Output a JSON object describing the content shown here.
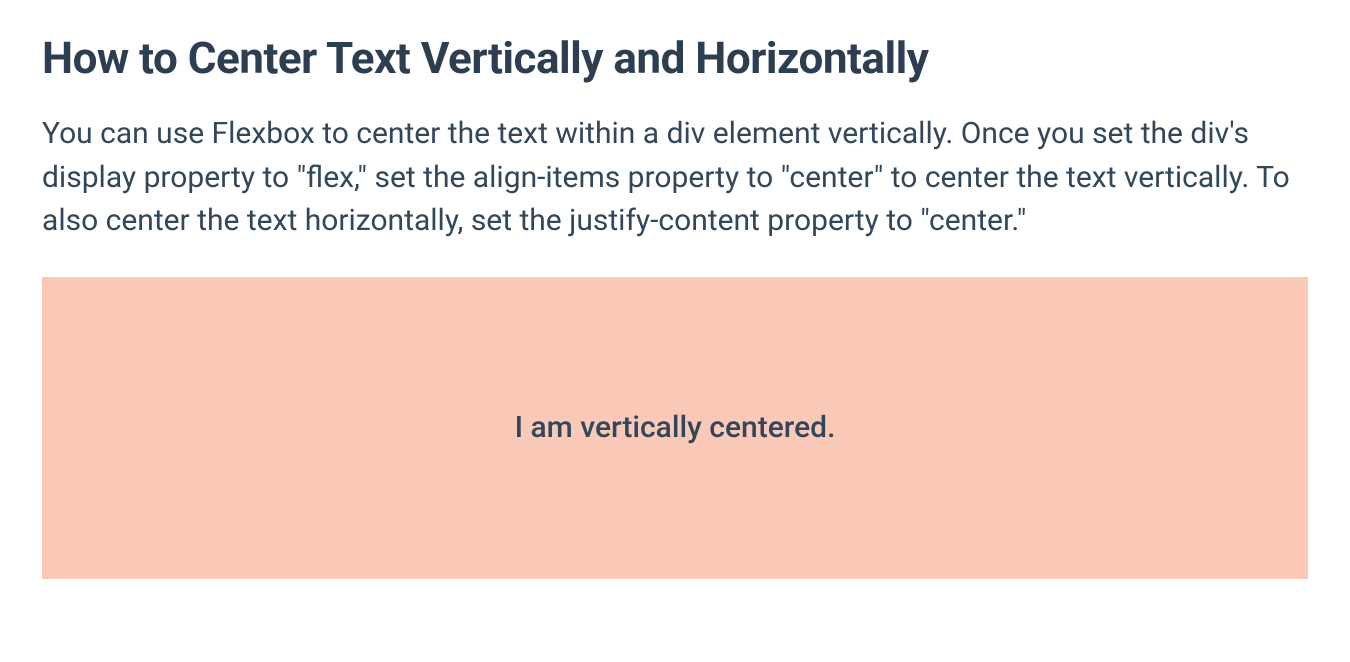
{
  "heading": "How to Center Text Vertically and Horizontally",
  "paragraph": "You can use Flexbox to center the text within a div element vertically. Once you set the div's display property to \"flex,\" set the align-items property to \"center\" to center the text vertically. To also center the text horizontally, set the justify-content property to \"center.\"",
  "demo": {
    "centered_text": "I am vertically centered."
  },
  "colors": {
    "heading": "#2c3e50",
    "body_text": "#33475b",
    "demo_bg": "#fbc9b8"
  }
}
